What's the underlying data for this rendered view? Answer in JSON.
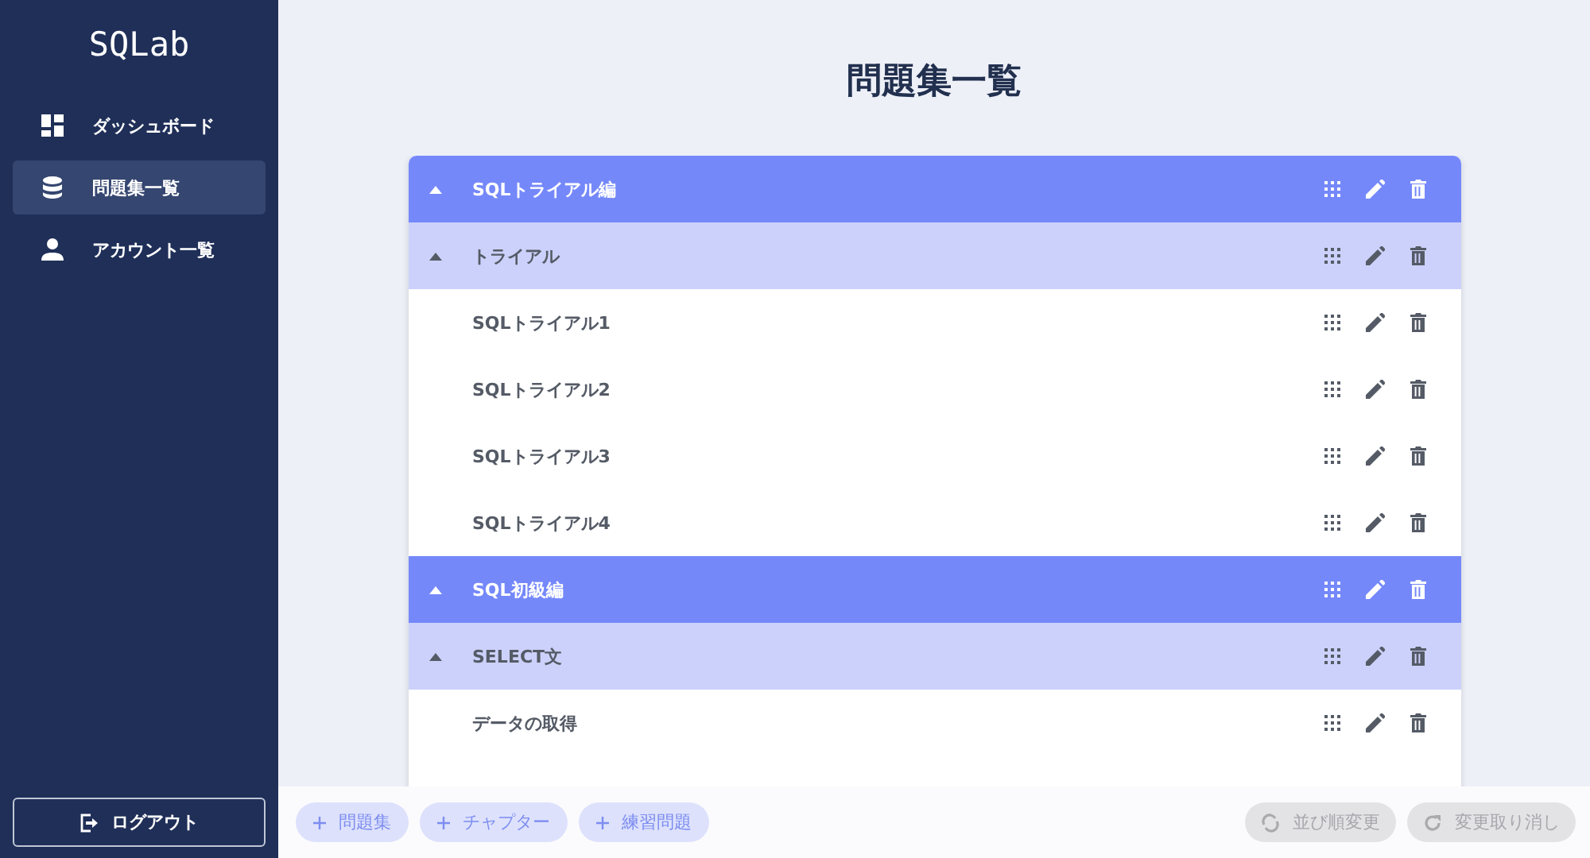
{
  "sidebar": {
    "logo": "SQLab",
    "items": [
      {
        "label": "ダッシュボード",
        "kind": "dashboard",
        "selected": false
      },
      {
        "label": "問題集一覧",
        "kind": "database",
        "selected": true
      },
      {
        "label": "アカウント一覧",
        "kind": "account",
        "selected": false
      }
    ],
    "logout": "ログアウト"
  },
  "page_title": "問題集一覧",
  "collections": [
    {
      "title": "SQLトライアル編",
      "expanded": true,
      "chapters": [
        {
          "title": "トライアル",
          "expanded": true,
          "problems": [
            "SQLトライアル1",
            "SQLトライアル2",
            "SQLトライアル3",
            "SQLトライアル4"
          ]
        }
      ]
    },
    {
      "title": "SQL初級編",
      "expanded": true,
      "chapters": [
        {
          "title": "SELECT文",
          "expanded": true,
          "problems": [
            "データの取得"
          ]
        }
      ]
    }
  ],
  "add_buttons": [
    "問題集",
    "チャプター",
    "練習問題"
  ],
  "action_buttons": [
    {
      "label": "並び順変更",
      "kind": "reorder",
      "disabled": true
    },
    {
      "label": "変更取り消し",
      "kind": "undo",
      "disabled": true
    }
  ]
}
